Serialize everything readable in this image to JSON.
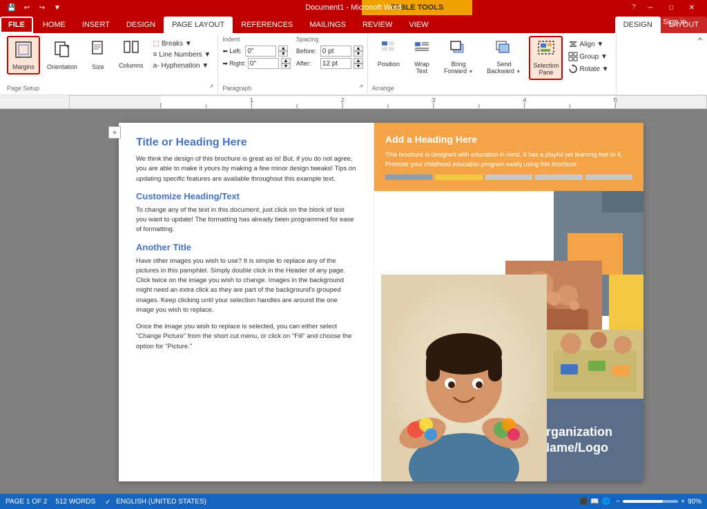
{
  "titleBar": {
    "title": "Document1 - Microsoft Word",
    "tableTools": "TABLE TOOLS",
    "controls": [
      "─",
      "□",
      "✕"
    ]
  },
  "ribbonTabs": {
    "tabs": [
      "FILE",
      "HOME",
      "INSERT",
      "DESIGN",
      "PAGE LAYOUT",
      "REFERENCES",
      "MAILINGS",
      "REVIEW",
      "VIEW",
      "DESIGN",
      "LAYOUT"
    ],
    "activeTab": "PAGE LAYOUT",
    "activeContext": "DESIGN",
    "contextGroup": "TABLE TOOLS",
    "signIn": "Sign in"
  },
  "ribbon": {
    "pageSetup": {
      "label": "Page Setup",
      "buttons": {
        "margins": "Margins",
        "orientation": "Orientation",
        "size": "Size",
        "columns": "Columns"
      },
      "subItems": [
        "Breaks ▼",
        "Line Numbers ▼",
        "Hyphenation ▼"
      ]
    },
    "paragraph": {
      "label": "Paragraph",
      "indent": {
        "leftLabel": "⬅ Left:",
        "leftValue": "0\"",
        "rightLabel": "➡ Right:",
        "rightValue": "0\""
      },
      "spacing": {
        "beforeLabel": "Before:",
        "beforeValue": "0 pt",
        "afterLabel": "After:",
        "afterValue": "12 pt"
      }
    },
    "arrange": {
      "label": "Arrange",
      "buttons": {
        "position": "Position",
        "wrapText": "Wrap\nText",
        "bringForward": "Bring\nForward",
        "sendBackward": "Send\nBackward",
        "selectionPane": "Selection\nPane",
        "align": "Align ▼",
        "group": "Group ▼",
        "rotate": "Rotate ▼"
      }
    }
  },
  "document": {
    "leftColumn": {
      "heading1": "Title or Heading Here",
      "body1": "We think the design of this brochure is great as is!  But, if you do not agree, you are able to make it yours by making a few minor design tweaks!  Tips on updating specific features are available throughout this example text.",
      "heading2": "Customize Heading/Text",
      "body2": "To change any of the text in this document, just click on the block of text you want to update!  The formatting has already been programmed for ease of formatting.",
      "heading3": "Another Title",
      "body3": "Have other images you wish to use?  It is simple to replace any of the pictures in this pamphlet.  Simply double click in the Header of any page.  Click twice on the image you wish to change.  Images in the background might need an extra click as they are part of the background's grouped images.  Keep clicking until your selection handles are around the one image you wish to replace.",
      "body4": "Once the image you wish to replace is selected, you can either select \"Change Picture\" from the short cut menu, or click on \"Fill\" and choose the option for \"Picture.\""
    },
    "rightColumn": {
      "orangeBox": {
        "heading": "Add a Heading Here",
        "body": "This brochure is designed with education in mind.  It has a playful yet learning feel to it.  Promote your childhood education program easily using this brochure."
      },
      "orgBox": {
        "text": "Organization Name/Logo"
      },
      "colorStrips": [
        "#8e9eb0",
        "#f4a446",
        "#c8c8c8",
        "#c8c8c8",
        "#c8c8c8"
      ]
    }
  },
  "statusBar": {
    "page": "PAGE 1 OF 2",
    "words": "512 WORDS",
    "language": "ENGLISH (UNITED STATES)",
    "zoom": "90%"
  }
}
